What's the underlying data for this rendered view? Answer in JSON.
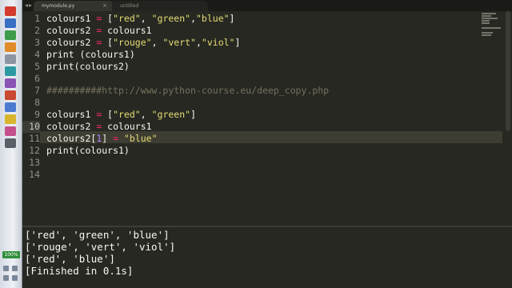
{
  "taskbar": {
    "battery_label": "100%",
    "icons": [
      {
        "name": "app-icon-red",
        "color": "#d23b2e"
      },
      {
        "name": "app-icon-blue",
        "color": "#3a6fc4"
      },
      {
        "name": "app-icon-green",
        "color": "#3d9b4a"
      },
      {
        "name": "app-icon-orange",
        "color": "#e08b2a"
      },
      {
        "name": "app-icon-gray",
        "color": "#8c95a3"
      },
      {
        "name": "app-icon-teal",
        "color": "#2d9aa3"
      },
      {
        "name": "app-icon-purple",
        "color": "#8a55b4"
      },
      {
        "name": "app-icon-red-2",
        "color": "#c9482f"
      },
      {
        "name": "app-icon-blue-2",
        "color": "#4b7bd1"
      },
      {
        "name": "app-icon-yellow",
        "color": "#d9b52e"
      },
      {
        "name": "app-icon-pink",
        "color": "#c44f8c"
      },
      {
        "name": "app-icon-dark",
        "color": "#5a5f68"
      }
    ]
  },
  "tabs": [
    {
      "label": "mymodule.py",
      "active": true
    },
    {
      "label": "untitled",
      "active": false
    }
  ],
  "editor": {
    "current_line": 10,
    "line_numbers": [
      "1",
      "2",
      "3",
      "4",
      "5",
      "6",
      "7",
      "8",
      "9",
      "10",
      "11",
      "12",
      "13",
      "14"
    ],
    "colors": {
      "background": "#272822",
      "string": "#e6db74",
      "operator": "#f92672",
      "number": "#ae81ff",
      "comment": "#75715e",
      "text": "#f8f8f2"
    }
  },
  "console": {
    "lines": [
      "['red', 'green', 'blue']",
      "['rouge', 'vert', 'viol']",
      "['red', 'blue']",
      "[Finished in 0.1s]"
    ]
  }
}
